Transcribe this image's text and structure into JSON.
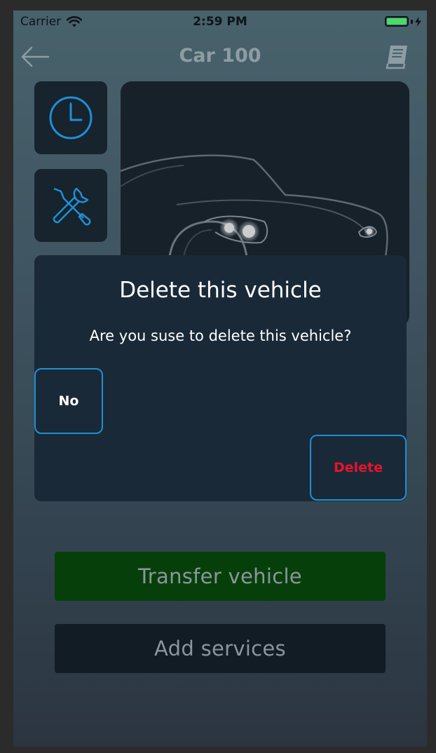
{
  "status_bar": {
    "carrier": "Carrier",
    "time": "2:59 PM",
    "battery_color": "#4cd964"
  },
  "nav": {
    "title": "Car 100",
    "back_icon": "back-arrow-icon",
    "right_icon": "book-icon"
  },
  "side_buttons": [
    {
      "icon": "clock-icon"
    },
    {
      "icon": "wrench-screwdriver-icon"
    }
  ],
  "buttons": {
    "transfer": "Transfer vehicle",
    "add_services": "Add services"
  },
  "dialog": {
    "title": "Delete this vehicle",
    "message": "Are you suse to delete this vehicle?",
    "no_label": "No",
    "delete_label": "Delete"
  },
  "colors": {
    "accent": "#1f8fd4",
    "danger": "#e8132a",
    "transfer_bg": "#073f0a"
  }
}
